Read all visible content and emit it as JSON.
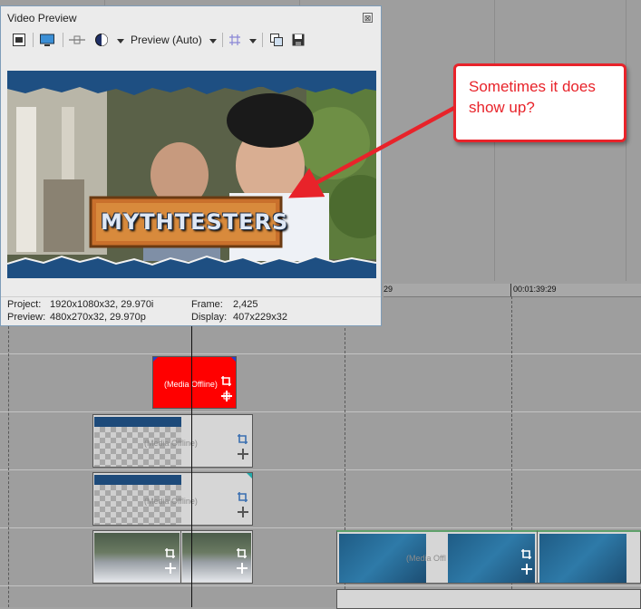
{
  "window": {
    "title": "Video Preview",
    "close_glyph": "⊠"
  },
  "toolbar": {
    "preview_quality": "Preview (Auto)",
    "icons": [
      "project-properties-icon",
      "external-monitor-icon",
      "split-screen-icon",
      "overlays-icon",
      "grid-icon",
      "copy-snapshot-icon",
      "save-snapshot-icon"
    ]
  },
  "preview": {
    "overlay_title": "MYTHTESTERS"
  },
  "info": {
    "project_label": "Project:",
    "project_value": "1920x1080x32, 29.970i",
    "preview_label": "Preview:",
    "preview_value": "480x270x32, 29.970p",
    "frame_label": "Frame:",
    "frame_value": "2,425",
    "display_label": "Display:",
    "display_value": "407x229x32"
  },
  "ruler": {
    "mark_left": "29",
    "mark_right": "00:01:39:29"
  },
  "tracks": {
    "media_offline": "(Media Offline)",
    "media_offline_trunc": "(Media Offl"
  },
  "callout": {
    "text": "Sometimes it does show up?",
    "color": "#e8232a"
  },
  "colors": {
    "offline_clip": "#ff0000",
    "timeline_bg": "#9e9e9e"
  }
}
